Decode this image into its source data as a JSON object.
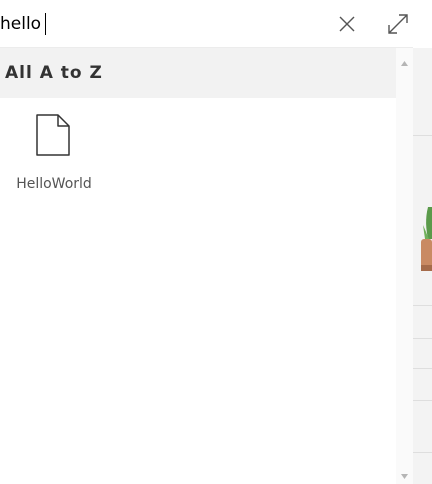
{
  "search": {
    "value": "hello",
    "clear_icon": "close-icon",
    "expand_icon": "expand-icon"
  },
  "results": {
    "group_title": "All A to Z",
    "items": [
      {
        "label": "HelloWorld",
        "icon": "file-icon"
      }
    ]
  },
  "scrollbar": {
    "up_icon": "scroll-up-arrow",
    "down_icon": "scroll-down-arrow"
  }
}
